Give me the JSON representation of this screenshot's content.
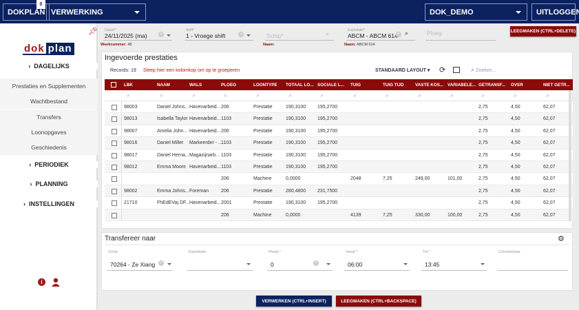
{
  "topbar": {
    "app": "DOKPLAN",
    "badge": "0",
    "module": "VERWERKING",
    "env": "DOK_DEMO",
    "logout": "UITLOGGEN"
  },
  "sidebar": {
    "logo": "dokplan",
    "items": [
      {
        "label": "DAGELIJKS",
        "type": "h"
      },
      {
        "label": "Prestaties en Supplementen",
        "type": "s"
      },
      {
        "label": "Wachtbestand",
        "type": "s"
      },
      {
        "label": "Transfers",
        "type": "s"
      },
      {
        "label": "Loonopgaves",
        "type": "s"
      },
      {
        "label": "Geschiedenis",
        "type": "s"
      },
      {
        "label": "PERIODIEK",
        "type": "h"
      },
      {
        "label": "PLANNING",
        "type": "h"
      },
      {
        "label": "INSTELLINGEN",
        "type": "h"
      }
    ]
  },
  "filters": {
    "datum_label": "Datum*",
    "datum": "24/11/2025 (ma)",
    "shift_label": "Shift*",
    "shift": "1 - Vroege shift",
    "schip_placeholder": "Schip*",
    "exploitatie_label": "Exploitatie*",
    "exploitatie": "ABCM - ABCM 614",
    "ploeg_placeholder": "Ploeg",
    "clear_button": "LEEGMAKEN (CTRL+DELETE)"
  },
  "info": {
    "week_label": "Weeknummer:",
    "week": "48",
    "naam1_label": "Naam:",
    "naam2_label": "Naam:",
    "naam2": "ABCM 614"
  },
  "grid": {
    "title": "Ingevoerde prestaties",
    "records": "Records: 19",
    "group_hint": "Sleep hier een kolomkop om op te groeperen",
    "layout": "STANDAARD LAYOUT",
    "search_placeholder": "Zoeken...",
    "columns": [
      "LBK",
      "NAAM",
      "WALS",
      "PLOEG",
      "LOONTYPE",
      "TOTAAL LO...",
      "SOCIALE L...",
      "TUIG",
      "TUIG TIJD",
      "VASTE KOS...",
      "VARIABELE...",
      "GETRANSF...",
      "OVER",
      "NIET GETR..."
    ],
    "rows": [
      [
        "98003",
        "Daniel Johns...",
        "Havenarbeid...",
        "206",
        "Prestatie",
        "190,3100",
        "195,2700",
        "",
        "",
        "",
        "",
        "2,75",
        "4,50",
        "62,07"
      ],
      [
        "98013",
        "Isabella Taylor",
        "Havenarbeid...",
        "1103",
        "Prestatie",
        "190,3100",
        "195,2700",
        "",
        "",
        "",
        "",
        "2,75",
        "4,50",
        "62,07"
      ],
      [
        "98007",
        "Amelia John...",
        "Havenarbeid...",
        "206",
        "Prestatie",
        "190,3100",
        "195,2700",
        "",
        "",
        "",
        "",
        "2,75",
        "4,50",
        "62,07"
      ],
      [
        "98016",
        "Daniel Miller",
        "Markeerder - ...",
        "1103",
        "Prestatie",
        "190,3100",
        "195,2700",
        "",
        "",
        "",
        "",
        "2,75",
        "4,50",
        "62,07"
      ],
      [
        "98017",
        "Daniel Herna...",
        "Magazijnarb...",
        "1103",
        "Prestatie",
        "190,3100",
        "195,2700",
        "",
        "",
        "",
        "",
        "2,75",
        "4,50",
        "62,07"
      ],
      [
        "98012",
        "Emma Moore",
        "Havenarbeid...",
        "1103",
        "Prestatie",
        "190,3100",
        "195,2700",
        "",
        "",
        "",
        "",
        "2,75",
        "4,50",
        "62,07"
      ],
      [
        "",
        "",
        "",
        "206",
        "Machine",
        "0,0000",
        "",
        "2048",
        "7,25",
        "249,00",
        "101,00",
        "2,75",
        "4,50",
        "62,07"
      ],
      [
        "98002",
        "Emma Johns...",
        "Foreman",
        "206",
        "Prestatie",
        "280,4800",
        "231,7500",
        "",
        "",
        "",
        "",
        "2,75",
        "4,50",
        "62,07"
      ],
      [
        "21710",
        "FhEdEVaj DF...",
        "Havenarbeid...",
        "2001",
        "Prestatie",
        "190,3100",
        "195,2700",
        "",
        "",
        "",
        "",
        "2,75",
        "4,50",
        "62,07"
      ],
      [
        "",
        "",
        "",
        "206",
        "Machine",
        "0,0000",
        "",
        "4139",
        "7,25",
        "330,00",
        "100,00",
        "2,75",
        "4,50",
        "62,07"
      ]
    ]
  },
  "transfer": {
    "title": "Transfereer naar",
    "fields": [
      {
        "label": "Schip",
        "value": "70264 - Ze Xiang"
      },
      {
        "label": "Exploitatie",
        "value": ""
      },
      {
        "label": "Ploeg *",
        "value": "0"
      },
      {
        "label": "Vanaf *",
        "value": "06:00"
      },
      {
        "label": "Tot *",
        "value": "13:45"
      },
      {
        "label": "Commentaar",
        "value": ""
      }
    ]
  },
  "actions": {
    "process": "VERWERKEN (CTRL+INSERT)",
    "clear": "LEEGMAKEN (CTRL+BACKSPACE)"
  },
  "colors": {
    "navy": "#0b2160",
    "red": "#8b0b0b"
  }
}
